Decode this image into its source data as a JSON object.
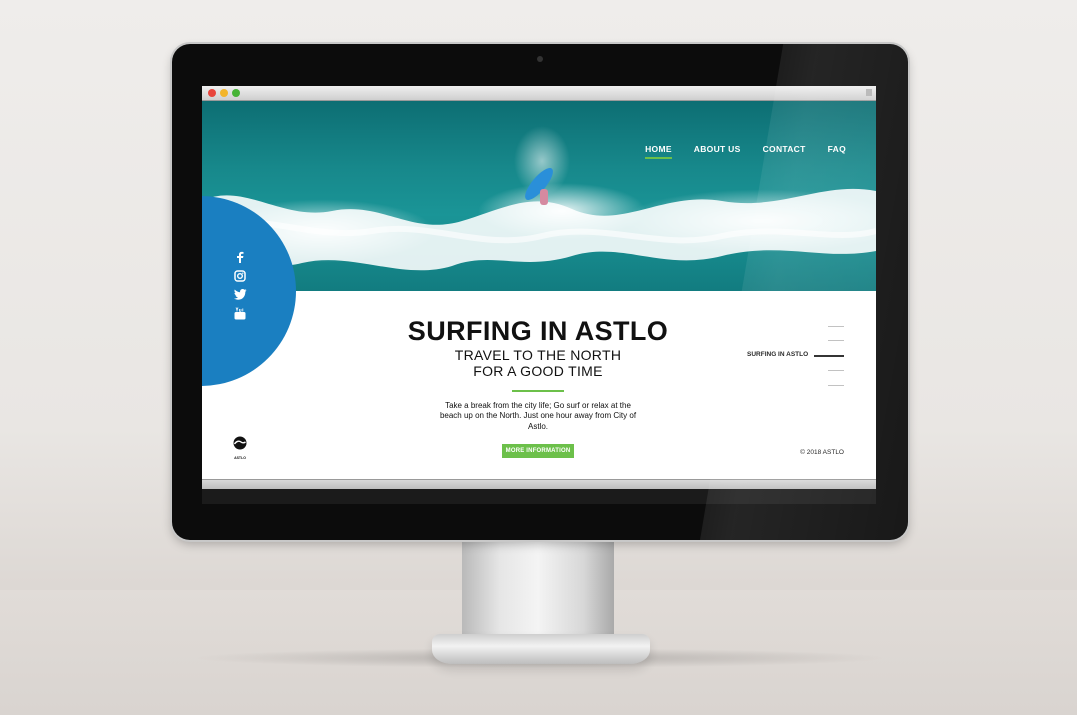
{
  "nav": {
    "items": [
      {
        "label": "HOME",
        "active": true
      },
      {
        "label": "ABOUT US",
        "active": false
      },
      {
        "label": "CONTACT",
        "active": false
      },
      {
        "label": "FAQ",
        "active": false
      }
    ]
  },
  "hero": {
    "title": "SURFING IN ASTLO",
    "subtitle_line1": "TRAVEL TO THE NORTH",
    "subtitle_line2": "FOR A GOOD TIME",
    "description": "Take a break from the city life; Go surf or relax at the beach up on the North. Just one hour away from City of Astlo.",
    "cta_label": "MORE INFORMATION"
  },
  "social": [
    "facebook-icon",
    "instagram-icon",
    "twitter-icon",
    "youtube-icon"
  ],
  "side_nav": {
    "active_label": "SURFING IN ASTLO"
  },
  "footer": {
    "logo_text": "ASTLO",
    "copyright": "© 2018 ASTLO"
  },
  "colors": {
    "accent_green": "#6cc04a",
    "circle_blue": "#1a7fc1",
    "ocean": "#17888b"
  }
}
